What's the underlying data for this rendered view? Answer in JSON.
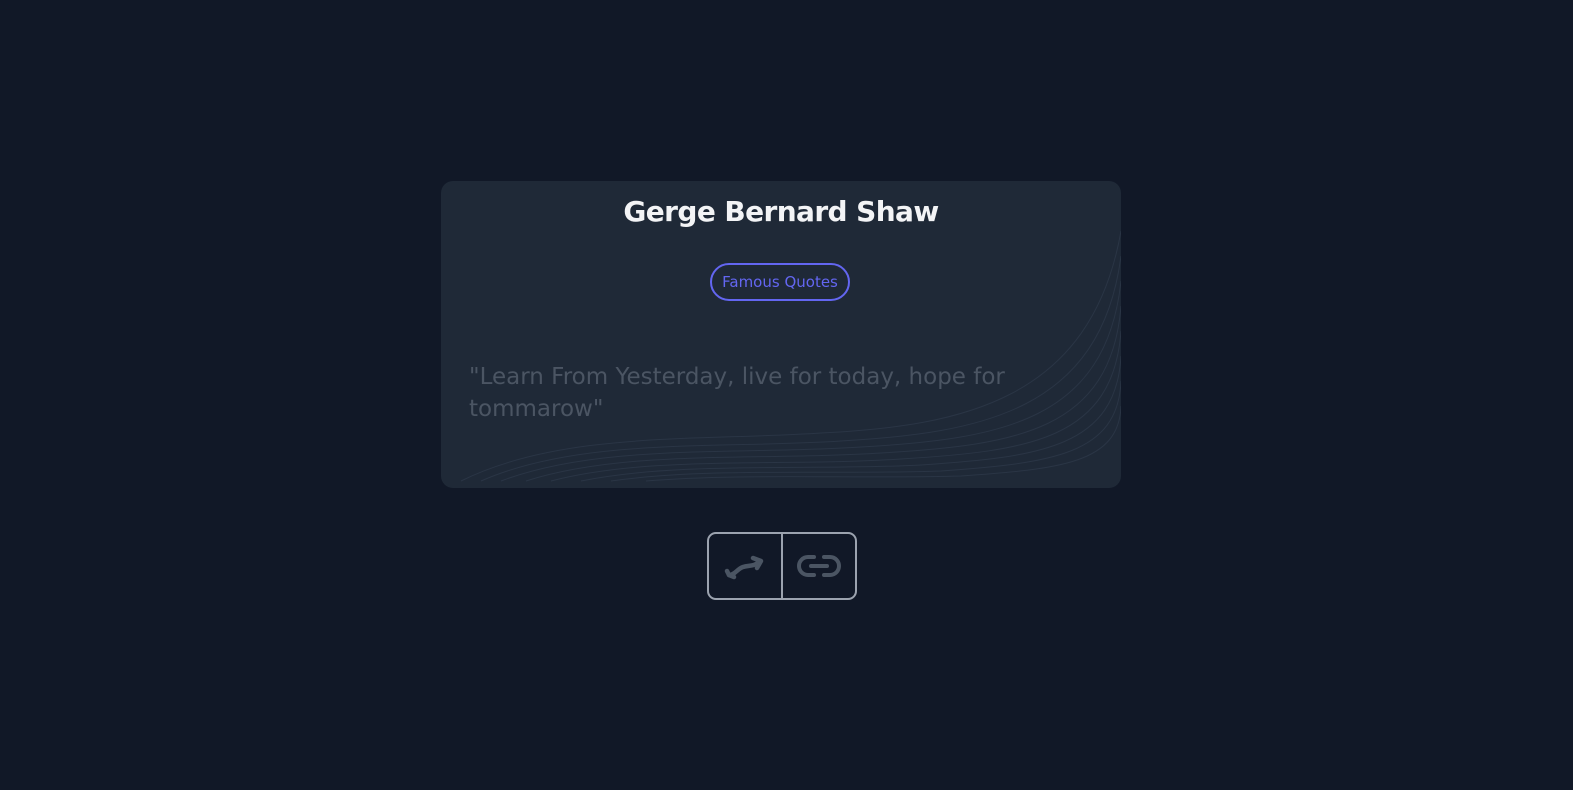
{
  "card": {
    "author": "Gerge Bernard Shaw",
    "tag": "Famous Quotes",
    "quote": "\"Learn From Yesterday, live for today, hope for tommarow\""
  },
  "controls": {
    "shuffle_icon": "shuffle-arrows-icon",
    "link_icon": "link-icon"
  },
  "colors": {
    "background": "#111827",
    "card": "#1f2937",
    "accent": "#6366f1",
    "author_text": "#f3f4f6",
    "quote_text": "#4b5563",
    "control_border": "#9ca3af",
    "icon": "#4b5563"
  }
}
